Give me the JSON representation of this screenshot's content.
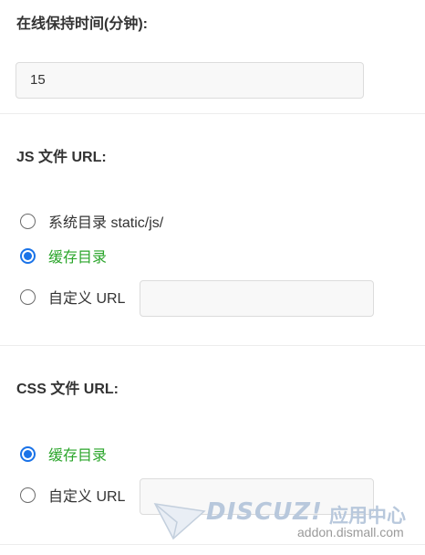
{
  "online_time": {
    "label": "在线保持时间(分钟):",
    "value": "15"
  },
  "js_url": {
    "label": "JS 文件 URL:",
    "options": [
      {
        "label": "系统目录 static/js/",
        "checked": false
      },
      {
        "label": "缓存目录",
        "checked": true
      },
      {
        "label": "自定义 URL",
        "checked": false
      }
    ],
    "custom_value": ""
  },
  "css_url": {
    "label": "CSS 文件 URL:",
    "options": [
      {
        "label": "缓存目录",
        "checked": true
      },
      {
        "label": "自定义 URL",
        "checked": false
      }
    ],
    "custom_value": ""
  },
  "watermark": {
    "logo": "DISCUZ!",
    "app_center": "应用中心",
    "site": "addon.dismall.com"
  },
  "colors": {
    "radio_checked": "#1a73e8",
    "checked_label": "#2aa52a",
    "input_bg": "#f8f8f8"
  }
}
